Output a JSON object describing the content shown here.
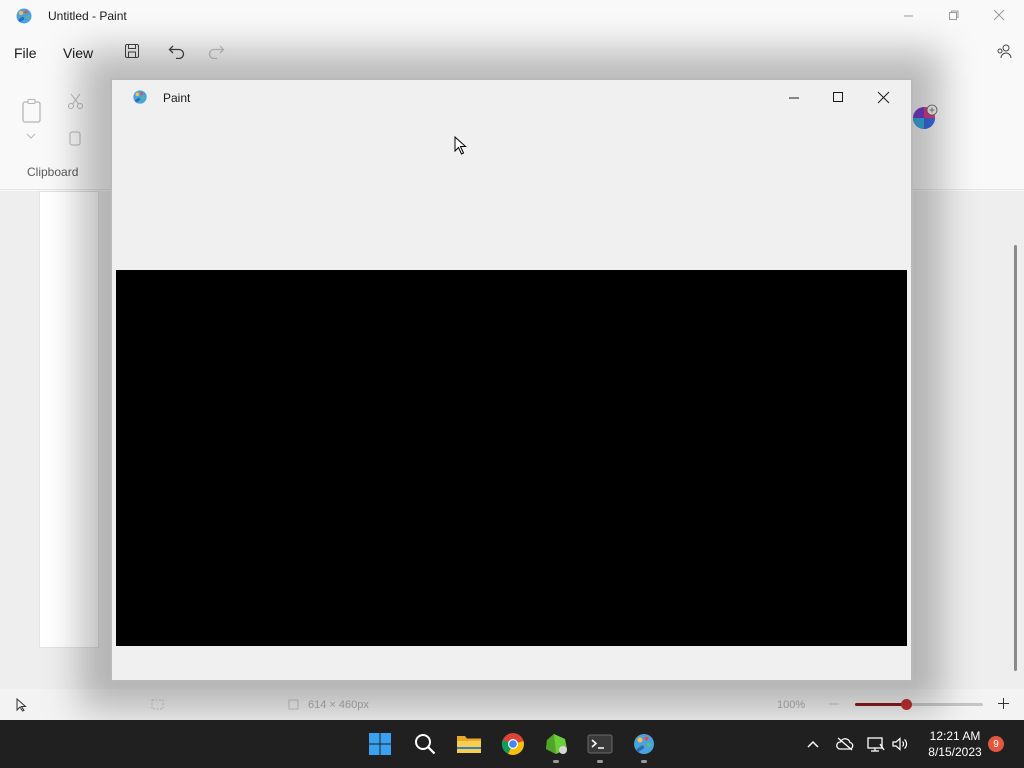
{
  "background_app": {
    "title": "Untitled - Paint",
    "menu": [
      "File",
      "View"
    ],
    "ribbon_group_label": "Clipboard",
    "status": {
      "canvas_size": "614 × 460px",
      "zoom": "100%",
      "zoom_level_fraction": 0.4
    }
  },
  "dialog": {
    "title": "Paint"
  },
  "taskbar": {
    "apps": [
      "start-icon",
      "search-icon",
      "file-explorer-icon",
      "chrome-icon",
      "gem-app-icon",
      "terminal-icon",
      "paint-icon"
    ],
    "clock_time": "12:21 AM",
    "clock_date": "8/15/2023",
    "notification_count": "9"
  },
  "colors": {
    "taskbar_bg": "#202020",
    "zoom_accent": "#c23232",
    "dialog_content": "#000000"
  }
}
